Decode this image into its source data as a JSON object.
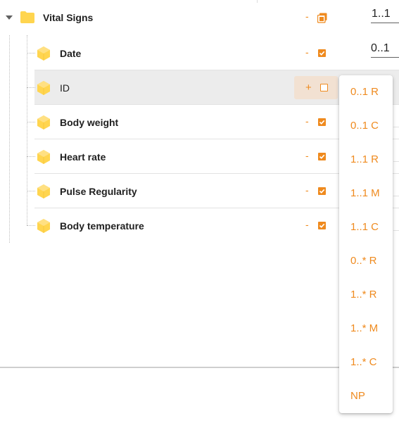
{
  "tree": {
    "root": {
      "label": "Vital Signs",
      "dash": "-",
      "cardinality": "1..1"
    },
    "children": [
      {
        "label": "Date",
        "dash": "-",
        "checked": true,
        "cardinality": "0..1"
      },
      {
        "label": "ID",
        "plus": "+",
        "checked": false
      },
      {
        "label": "Body weight",
        "dash": "-",
        "checked": true
      },
      {
        "label": "Heart rate",
        "dash": "-",
        "checked": true
      },
      {
        "label": "Pulse Regularity",
        "dash": "-",
        "checked": true
      },
      {
        "label": "Body temperature",
        "dash": "-",
        "checked": true
      }
    ]
  },
  "dropdown": {
    "options": [
      "0..1 R",
      "0..1 C",
      "1..1 R",
      "1..1 M",
      "1..1 C",
      "0..* R",
      "1..* R",
      "1..* M",
      "1..* C",
      "NP"
    ]
  },
  "colors": {
    "accent": "#ef8a1e",
    "folder": "#ffd54f",
    "highlight": "#ececec"
  }
}
